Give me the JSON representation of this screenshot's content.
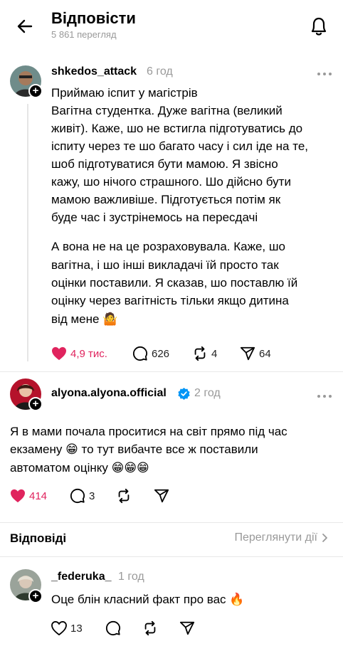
{
  "header": {
    "title": "Відповісти",
    "views": "5 861 перегляд"
  },
  "post": {
    "username": "shkedos_attack",
    "time": "6 год",
    "paragraph1": [
      "Приймаю іспит у магістрів",
      "Вагітна студентка. Дуже вагітна (великий",
      "живіт). Каже, шо не встигла підготуватись до",
      "іспиту через те шо багато часу і сил іде на те,",
      "шоб підготуватися бути мамою. Я звісно",
      "кажу, шо нічого страшного. Шо дійсно бути",
      "мамою важливіше. Підготується потім як",
      "буде час і зустрінемось на пересдачі"
    ],
    "paragraph2": [
      "А вона не на це розраховувала. Каже, шо",
      "вагітна, і шо інші викладачі їй просто так",
      "оцінки поставили. Я сказав, шо поставлю їй",
      "оцінку через вагітність тільки якщо дитина",
      "від мене 🤷"
    ],
    "likes": "4,9 тис.",
    "comments": "626",
    "reposts": "4",
    "shares": "64"
  },
  "reply1": {
    "username": "alyona.alyona.official",
    "verified": true,
    "time": "2 год",
    "lines": [
      "Я в мами почала проситися на світ прямо під час",
      "екзамену 😁 то тут вибачте все ж поставили",
      "автоматом оцінку 😁😁😁"
    ],
    "likes": "414",
    "comments": "3"
  },
  "replies_bar": {
    "label": "Відповіді",
    "view_activity": "Переглянути дії"
  },
  "reply2": {
    "username": "_federuka_",
    "time": "1 год",
    "lines": [
      "Оце блін класний факт про вас 🔥"
    ],
    "likes": "13"
  },
  "colors": {
    "like_red": "#e0245e",
    "verified_blue": "#0095f6",
    "muted": "#999999"
  }
}
